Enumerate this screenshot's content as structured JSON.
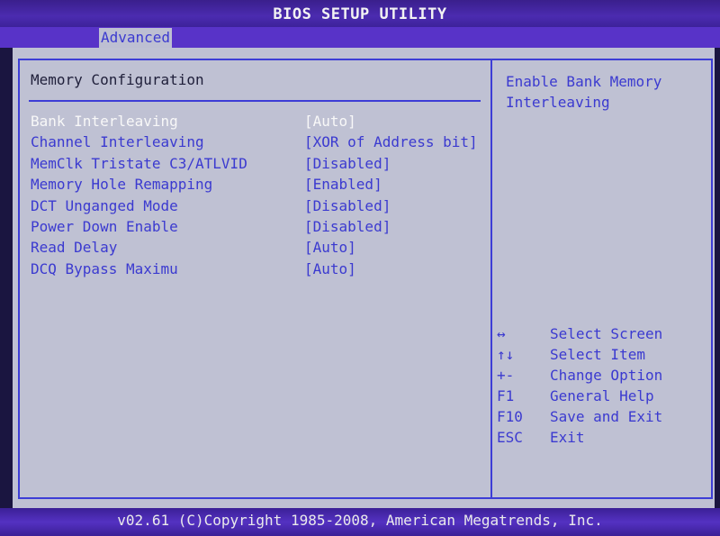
{
  "window": {
    "title": "BIOS SETUP UTILITY"
  },
  "tabs": [
    {
      "label": "Advanced",
      "active": true
    }
  ],
  "section": {
    "title": "Memory Configuration"
  },
  "settings": [
    {
      "label": "Bank Interleaving",
      "value": "[Auto]",
      "selected": true
    },
    {
      "label": "Channel Interleaving",
      "value": "[XOR of Address bit]"
    },
    {
      "label": "MemClk Tristate C3/ATLVID",
      "value": "[Disabled]"
    },
    {
      "label": "Memory Hole Remapping",
      "value": "[Enabled]"
    },
    {
      "label": "DCT Unganged Mode",
      "value": "[Disabled]"
    },
    {
      "label": "Power Down Enable",
      "value": "[Disabled]"
    },
    {
      "label": "Read Delay",
      "value": "[Auto]"
    },
    {
      "label": "DCQ Bypass Maximu",
      "value": "[Auto]"
    }
  ],
  "help": {
    "line1": "Enable Bank Memory",
    "line2": "Interleaving"
  },
  "keys": [
    {
      "key": "↔",
      "desc": "Select Screen"
    },
    {
      "key": "↑↓",
      "desc": "Select Item"
    },
    {
      "key": "+-",
      "desc": "Change Option"
    },
    {
      "key": "F1",
      "desc": "General Help"
    },
    {
      "key": "F10",
      "desc": "Save and Exit"
    },
    {
      "key": "ESC",
      "desc": "Exit"
    }
  ],
  "footer": {
    "text": "v02.61 (C)Copyright 1985-2008, American Megatrends, Inc."
  },
  "colors": {
    "panel": "#bfc1d3",
    "accent_blue": "#3b3ad0",
    "title_purple": "#4b2bb0",
    "selected_text": "#f8f8f8"
  }
}
